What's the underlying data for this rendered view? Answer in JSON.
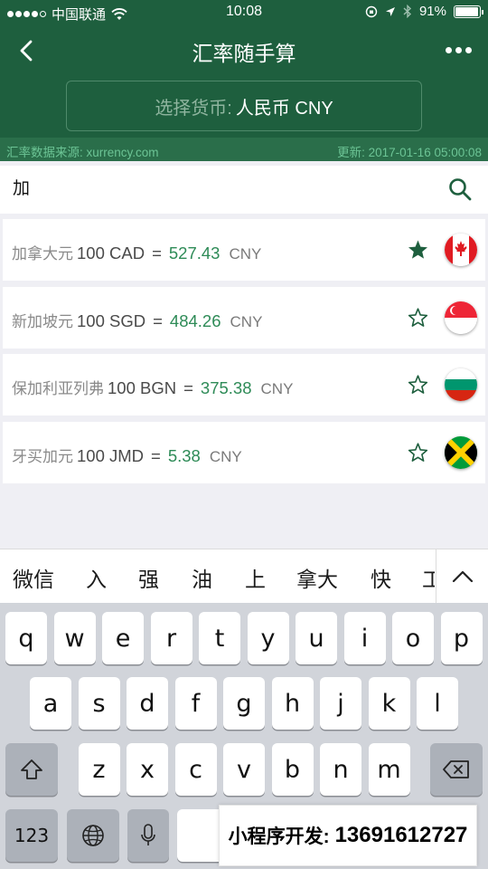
{
  "status_bar": {
    "carrier": "中国联通",
    "time": "10:08",
    "battery": "91%"
  },
  "nav": {
    "title": "汇率随手算"
  },
  "currency_select": {
    "label": "选择货币:",
    "value": "人民币 CNY"
  },
  "source_bar": {
    "source": "汇率数据来源: xurrency.com",
    "updated": "更新: 2017-01-16 05:00:08"
  },
  "search": {
    "query": "加"
  },
  "rates": [
    {
      "name": "加拿大元",
      "base": "100 CAD",
      "eq": "=",
      "value": "527.43",
      "unit": "CNY",
      "starred": true,
      "flag": "canada-flag-icon"
    },
    {
      "name": "新加坡元",
      "base": "100 SGD",
      "eq": "=",
      "value": "484.26",
      "unit": "CNY",
      "starred": false,
      "flag": "singapore-flag-icon"
    },
    {
      "name": "保加利亚列弗",
      "base": "100 BGN",
      "eq": "=",
      "value": "375.38",
      "unit": "CNY",
      "starred": false,
      "flag": "bulgaria-flag-icon"
    },
    {
      "name": "牙买加元",
      "base": "100 JMD",
      "eq": "=",
      "value": "5.38",
      "unit": "CNY",
      "starred": false,
      "flag": "jamaica-flag-icon"
    }
  ],
  "candidates": [
    "微信",
    "入",
    "强",
    "油",
    "上",
    "拿大",
    "快",
    "工"
  ],
  "keyboard": {
    "row1": [
      "q",
      "w",
      "e",
      "r",
      "t",
      "y",
      "u",
      "i",
      "o",
      "p"
    ],
    "row2": [
      "a",
      "s",
      "d",
      "f",
      "g",
      "h",
      "j",
      "k",
      "l"
    ],
    "row3": [
      "z",
      "x",
      "c",
      "v",
      "b",
      "n",
      "m"
    ],
    "numbers_key": "123"
  },
  "watermark": {
    "label": "小程序开发:",
    "phone": "13691612727"
  },
  "colors": {
    "header_bg": "#1e5f3e",
    "accent_green": "#2e8b57",
    "source_text": "#6cc495"
  }
}
